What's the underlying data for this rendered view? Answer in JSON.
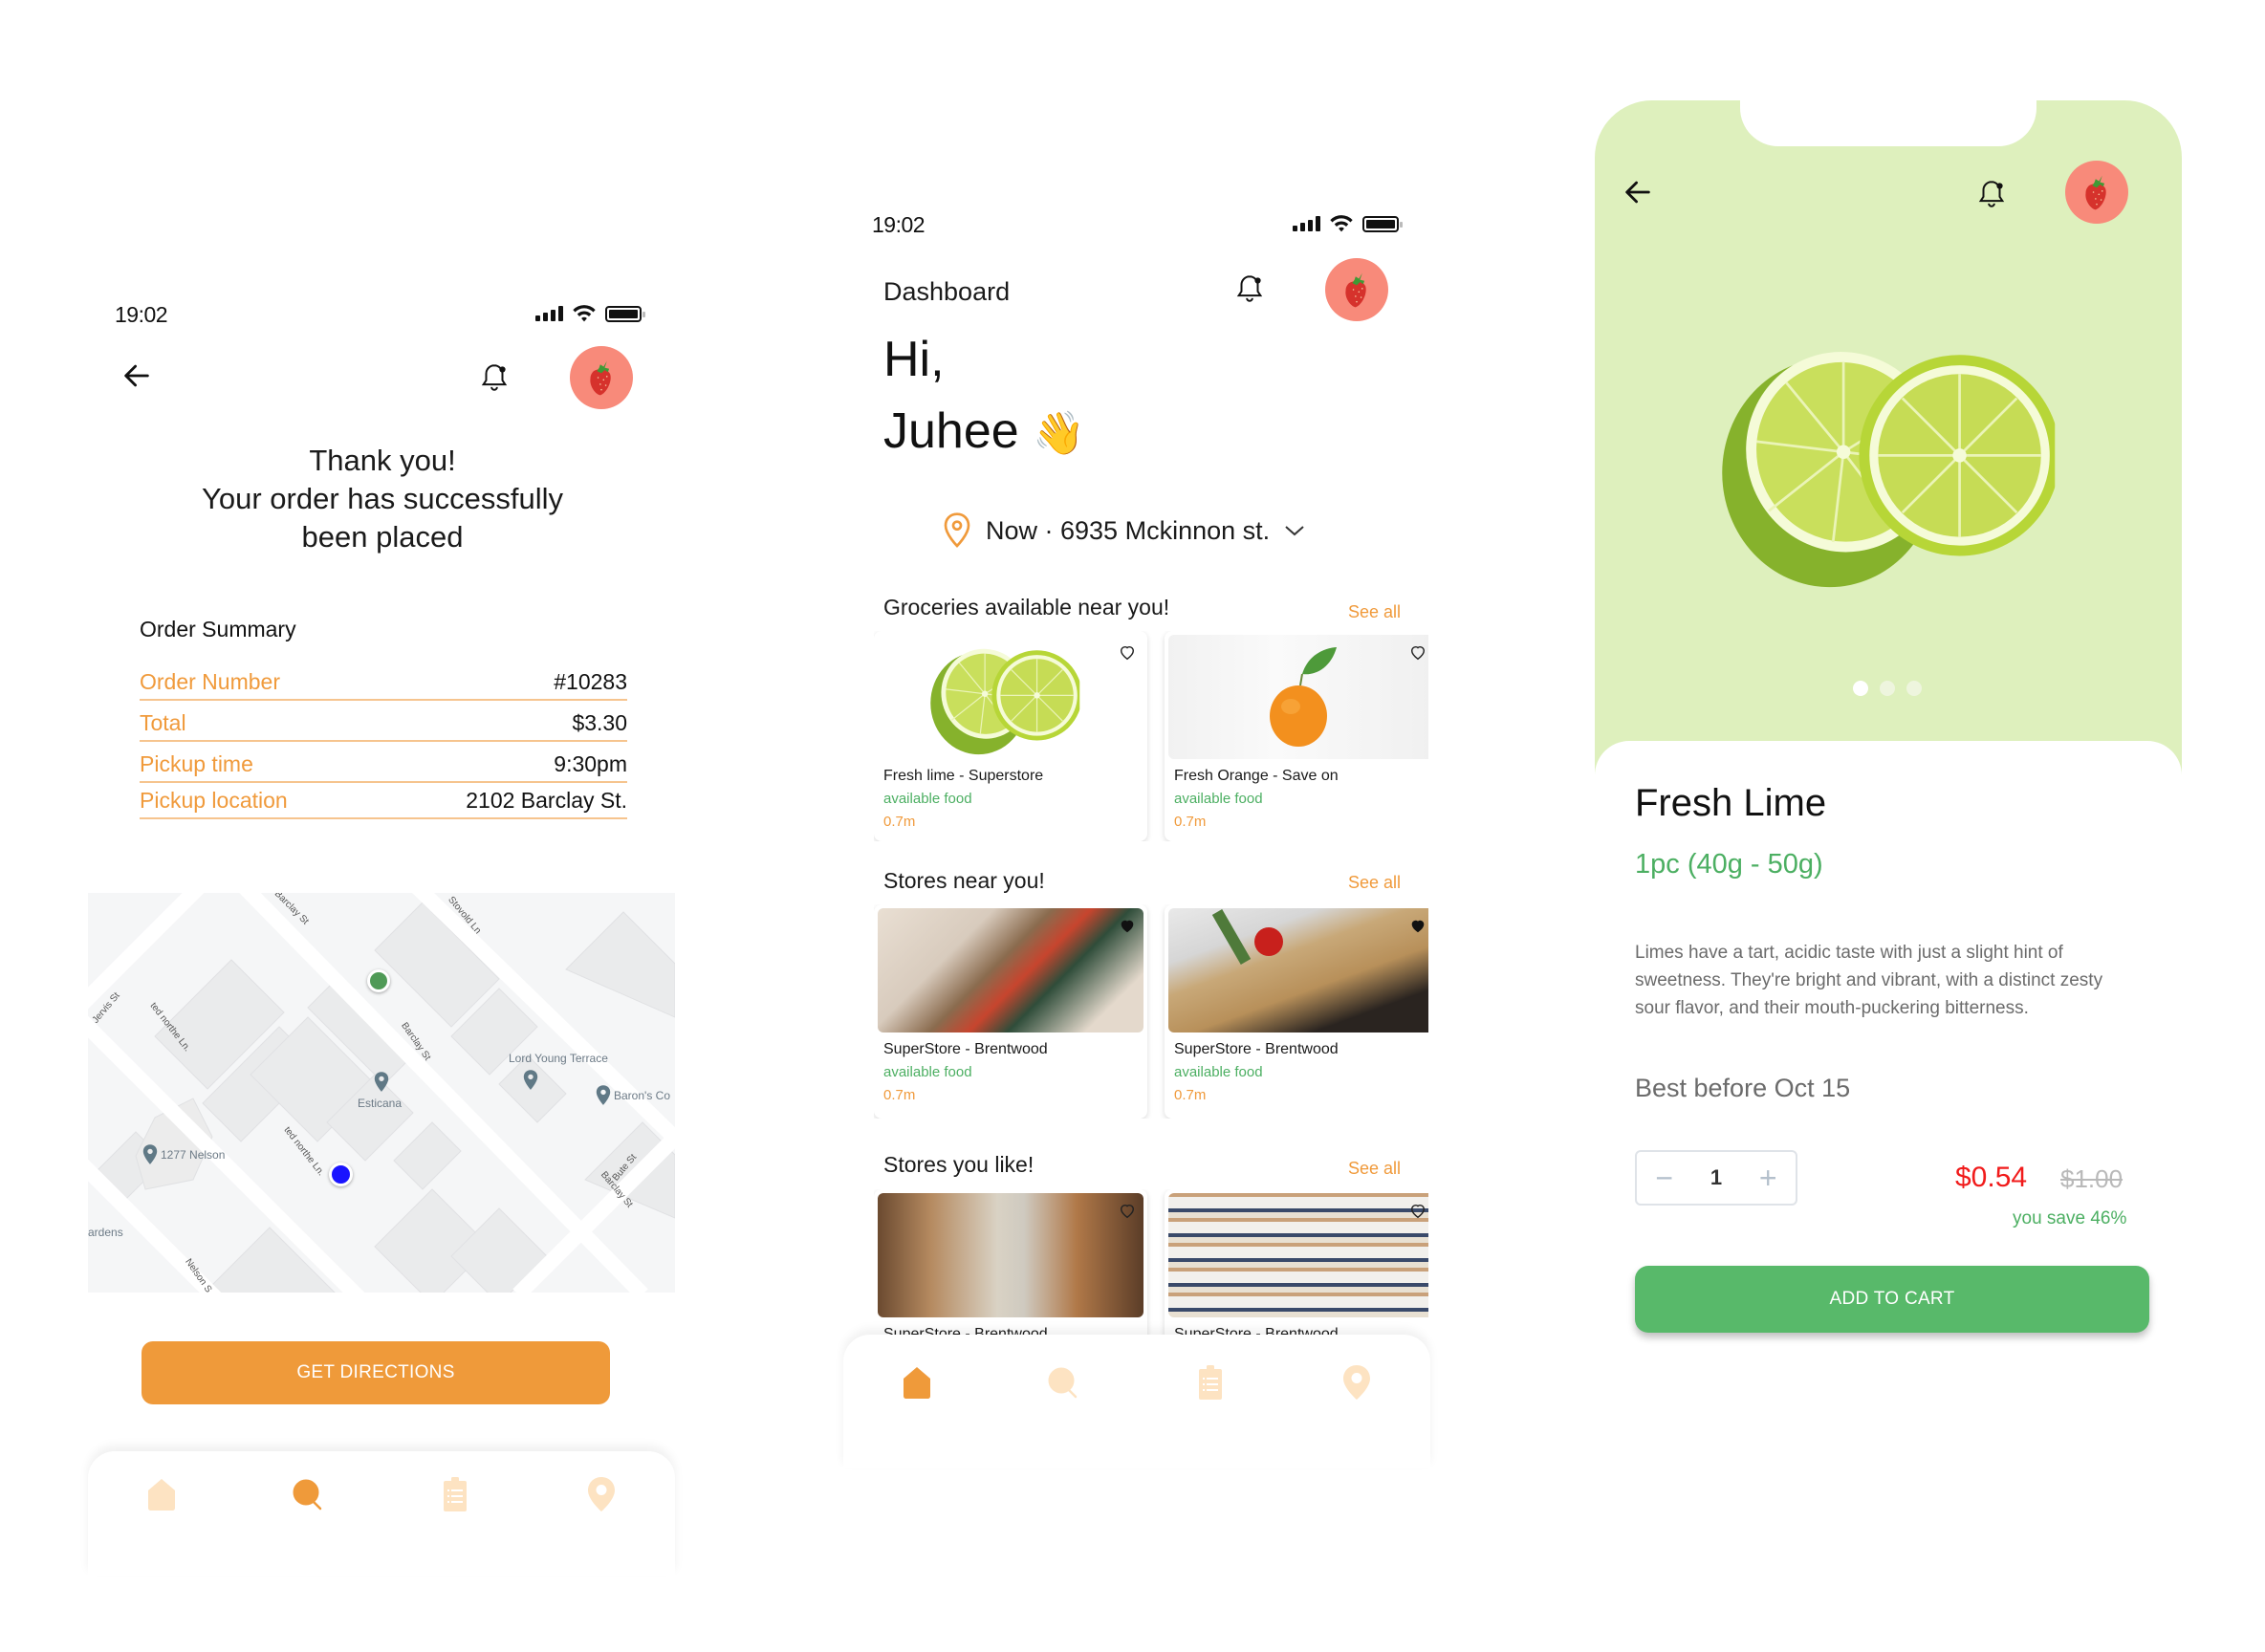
{
  "screens": {
    "order_confirmation": {
      "status_time": "19:02",
      "message_line1": "Thank you!",
      "message_line2": "Your order has successfully",
      "message_line3": "been placed",
      "summary_title": "Order Summary",
      "summary_rows": [
        {
          "label": "Order Number",
          "value": "#10283"
        },
        {
          "label": "Total",
          "value": "$3.30"
        },
        {
          "label": "Pickup time",
          "value": "9:30pm"
        },
        {
          "label": "Pickup location",
          "value": "2102 Barclay St."
        }
      ],
      "map": {
        "places": [
          "Esticana",
          "Lord Young Terrace",
          "Baron's Co",
          "1277 Nelson",
          "ardens"
        ],
        "streets": [
          "Barclay St",
          "Barclay St",
          "Barclay St",
          "Stovold Ln",
          "ted northe Ln.",
          "ted northe Ln.",
          "Jervis St",
          "Bute St",
          "Nelson S"
        ]
      },
      "button_label": "GET DIRECTIONS",
      "active_tab": "search"
    },
    "dashboard": {
      "status_time": "19:02",
      "header_title": "Dashboard",
      "greeting": "Hi,",
      "user_name": "Juhee",
      "wave_emoji": "👋",
      "location_text": "Now · 6935 Mckinnon st.",
      "sections": [
        {
          "title": "Groceries available near you!",
          "see_all": "See all",
          "cards": [
            {
              "name": "Fresh lime - Superstore",
              "status": "available food",
              "distance": "0.7m",
              "image": "lime"
            },
            {
              "name": "Fresh Orange - Save on",
              "status": "available food",
              "distance": "0.7m",
              "image": "orange"
            }
          ]
        },
        {
          "title": "Stores near you!",
          "see_all": "See all",
          "cards": [
            {
              "name": "SuperStore - Brentwood",
              "status": "available food",
              "distance": "0.7m",
              "image": "groceries-flatlay"
            },
            {
              "name": "SuperStore - Brentwood",
              "status": "available food",
              "distance": "0.7m",
              "image": "basket"
            }
          ]
        },
        {
          "title": "Stores you like!",
          "see_all": "See all",
          "cards": [
            {
              "name": "SuperStore - Brentwood",
              "image": "store-aisle"
            },
            {
              "name": "SuperStore - Brentwood",
              "image": "store-shelves"
            }
          ]
        }
      ],
      "active_tab": "home"
    },
    "product_detail": {
      "title": "Fresh Lime",
      "subtitle": "1pc (40g - 50g)",
      "description": "Limes have a tart, acidic taste with just a slight hint of sweetness. They're bright and vibrant, with a distinct zesty sour flavor, and their mouth-puckering bitterness.",
      "best_before": "Best before Oct 15",
      "quantity": "1",
      "minus": "−",
      "plus": "+",
      "price": "$0.54",
      "original_price": "$1.00",
      "savings": "you save 46%",
      "button_label": "ADD TO CART",
      "carousel": {
        "count": 3,
        "active_index": 0
      }
    }
  },
  "tabs": [
    "home",
    "search",
    "orders",
    "location"
  ],
  "colors": {
    "accent_orange": "#ef9a3a",
    "accent_orange_light": "#fde3c2",
    "success_green": "#58b96a",
    "price_red": "#f11b1b",
    "hero_bg": "#def0bd",
    "avatar_bg": "#f88a7a"
  }
}
